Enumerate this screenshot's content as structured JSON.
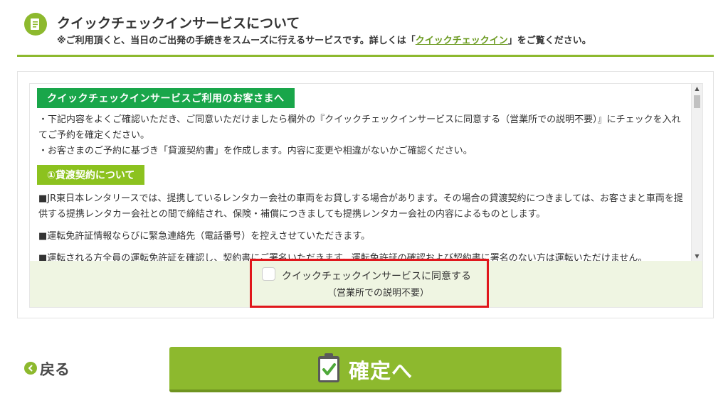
{
  "header": {
    "title": "クイックチェックインサービスについて",
    "subtitle_prefix": "※ご利用頂くと、当日のご出発の手続きをスムーズに行えるサービスです。詳しくは「",
    "subtitle_link": "クイックチェックイン",
    "subtitle_suffix": "」をご覧ください。",
    "icon": "document-icon"
  },
  "terms": {
    "heading": "クイックチェックインサービスご利用のお客さまへ",
    "intro_1": "・下記内容をよくご確認いただき、ご同意いただけましたら欄外の『クイックチェックインサービスに同意する（営業所での説明不要）』にチェックを入れてご予約を確定ください。",
    "intro_2": "・お客さまのご予約に基づき「貸渡契約書」を作成します。内容に変更や相違がないかご確認ください。",
    "section_1_heading": "①貸渡契約について",
    "section_1_para_1": "■JR東日本レンタリースでは、提携しているレンタカー会社の車両をお貸しする場合があります。その場合の貸渡契約につきましては、お客さまと車両を提供する提携レンタカー会社との間で締結され、保険・補償につきましても提携レンタカー会社の内容によるものとします。",
    "section_1_para_2": "■運転免許証情報ならびに緊急連絡先（電話番号）を控えさせていただきます。",
    "section_1_para_3": "■運転される方全員の運転免許証を確認し、契約書にご署名いただきます。運転免許証の確認および契約書に署名のない方は運転いただけません。"
  },
  "agreement": {
    "checkbox_label": "クイックチェックインサービスに同意する",
    "checkbox_note": "（営業所での説明不要）",
    "checked": false
  },
  "footer": {
    "back_label": "戻る",
    "confirm_label": "確定へ",
    "back_icon": "chevron-left-icon",
    "confirm_icon": "clipboard-check-icon"
  },
  "colors": {
    "accent": "#8db92e",
    "heading_green": "#19a64a",
    "subheading_lime": "#8cc21f",
    "highlight_red": "#e0161b",
    "agree_bg": "#eff5e2"
  }
}
